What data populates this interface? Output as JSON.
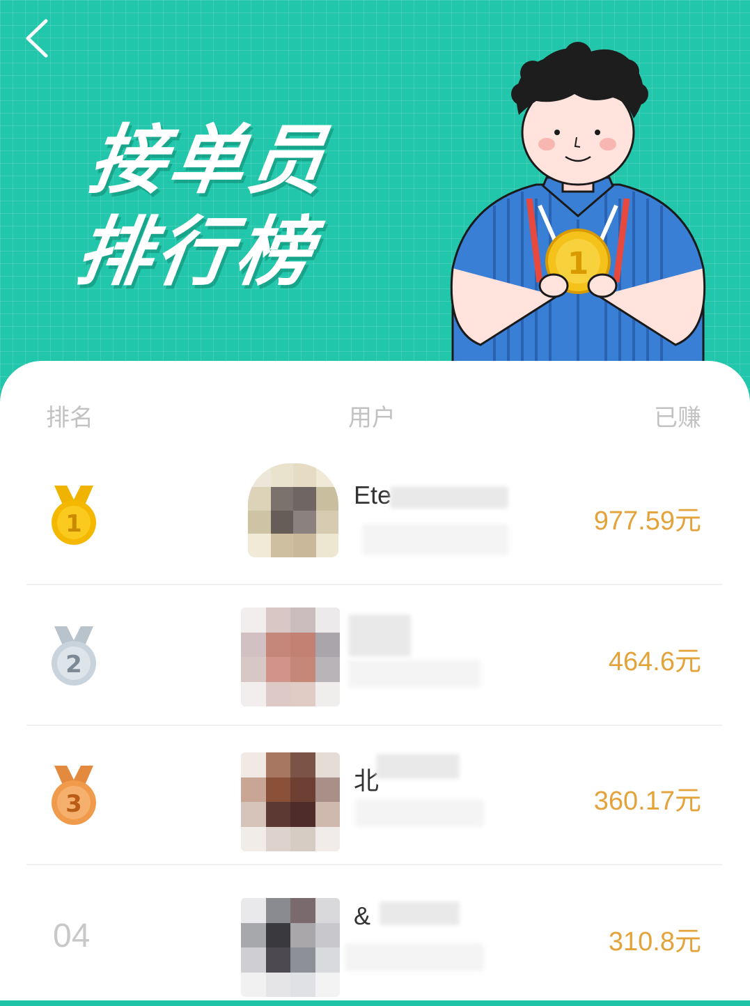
{
  "banner": {
    "title_line1": "接单员",
    "title_line2": "排行榜",
    "medal_number": "1",
    "background_color": "#22c6aa"
  },
  "table": {
    "col_rank": "排名",
    "col_user": "用户",
    "col_earned": "已赚"
  },
  "rows": [
    {
      "rank_medal": "1",
      "medal_color": "#f5b800",
      "name": "Ete",
      "earned": "977.59元"
    },
    {
      "rank_medal": "2",
      "medal_color": "#c9d3dc",
      "name": "",
      "earned": "464.6元"
    },
    {
      "rank_medal": "3",
      "medal_color": "#f09a4c",
      "name": "北",
      "earned": "360.17元"
    },
    {
      "rank_text": "04",
      "name": "&",
      "earned": "310.8元"
    }
  ],
  "colors": {
    "accent_earned": "#e3a33a",
    "header_text": "#c2c2c2"
  }
}
